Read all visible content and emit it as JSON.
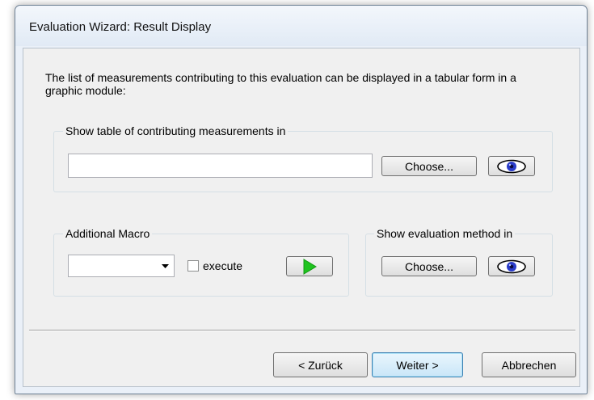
{
  "window": {
    "title": "Evaluation Wizard: Result Display"
  },
  "intro_text": "The list of measurements contributing to this evaluation can be displayed in a tabular form in a graphic module:",
  "table_group": {
    "label": "Show table of contributing measurements in",
    "input_value": "",
    "choose_label": "Choose..."
  },
  "macro_group": {
    "label": "Additional Macro",
    "selected": "",
    "execute_label": "execute",
    "execute_checked": false
  },
  "eval_group": {
    "label": "Show evaluation method in",
    "choose_label": "Choose..."
  },
  "footer": {
    "back_label": "< Zurück",
    "next_label": "Weiter >",
    "cancel_label": "Abbrechen"
  },
  "colors": {
    "eye_blue": "#2a3cc9",
    "play_green": "#1fc41f"
  },
  "icons": [
    "eye-icon",
    "play-icon",
    "dropdown-arrow-icon"
  ]
}
